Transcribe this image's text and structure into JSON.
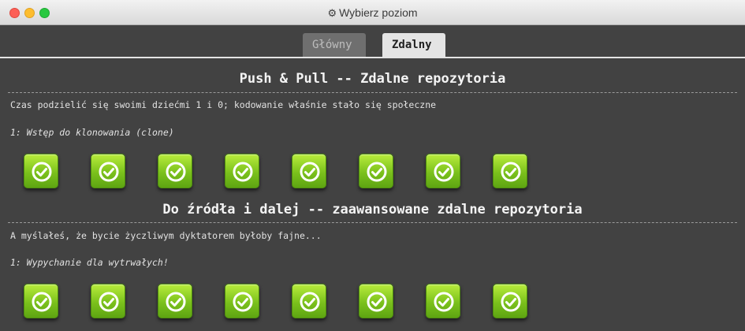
{
  "window": {
    "title": "Wybierz poziom",
    "title_icon": "gear-icon"
  },
  "tabs": [
    {
      "label": "Główny",
      "active": false
    },
    {
      "label": "Zdalny",
      "active": true
    }
  ],
  "sections": [
    {
      "title": "Push & Pull -- Zdalne repozytoria",
      "description": "Czas podzielić się swoimi dziećmi 1 i 0; kodowanie właśnie stało się społeczne",
      "level_label": "1: Wstęp do klonowania (clone)",
      "levels": [
        {
          "status": "completed"
        },
        {
          "status": "completed"
        },
        {
          "status": "completed"
        },
        {
          "status": "completed"
        },
        {
          "status": "completed"
        },
        {
          "status": "completed"
        },
        {
          "status": "completed"
        },
        {
          "status": "completed"
        }
      ]
    },
    {
      "title": "Do źródła i dalej -- zaawansowane zdalne repozytoria",
      "description": "A myślałeś, że bycie życzliwym dyktatorem byłoby fajne...",
      "level_label": "1: Wypychanie dla wytrwałych!",
      "levels": [
        {
          "status": "completed"
        },
        {
          "status": "completed"
        },
        {
          "status": "completed"
        },
        {
          "status": "completed"
        },
        {
          "status": "completed"
        },
        {
          "status": "completed"
        },
        {
          "status": "completed"
        },
        {
          "status": "completed"
        }
      ]
    }
  ],
  "colors": {
    "background": "#424242",
    "level_completed": "#7bc11c",
    "tab_active": "#e4e4e4",
    "tab_inactive": "#6f6f6f"
  }
}
